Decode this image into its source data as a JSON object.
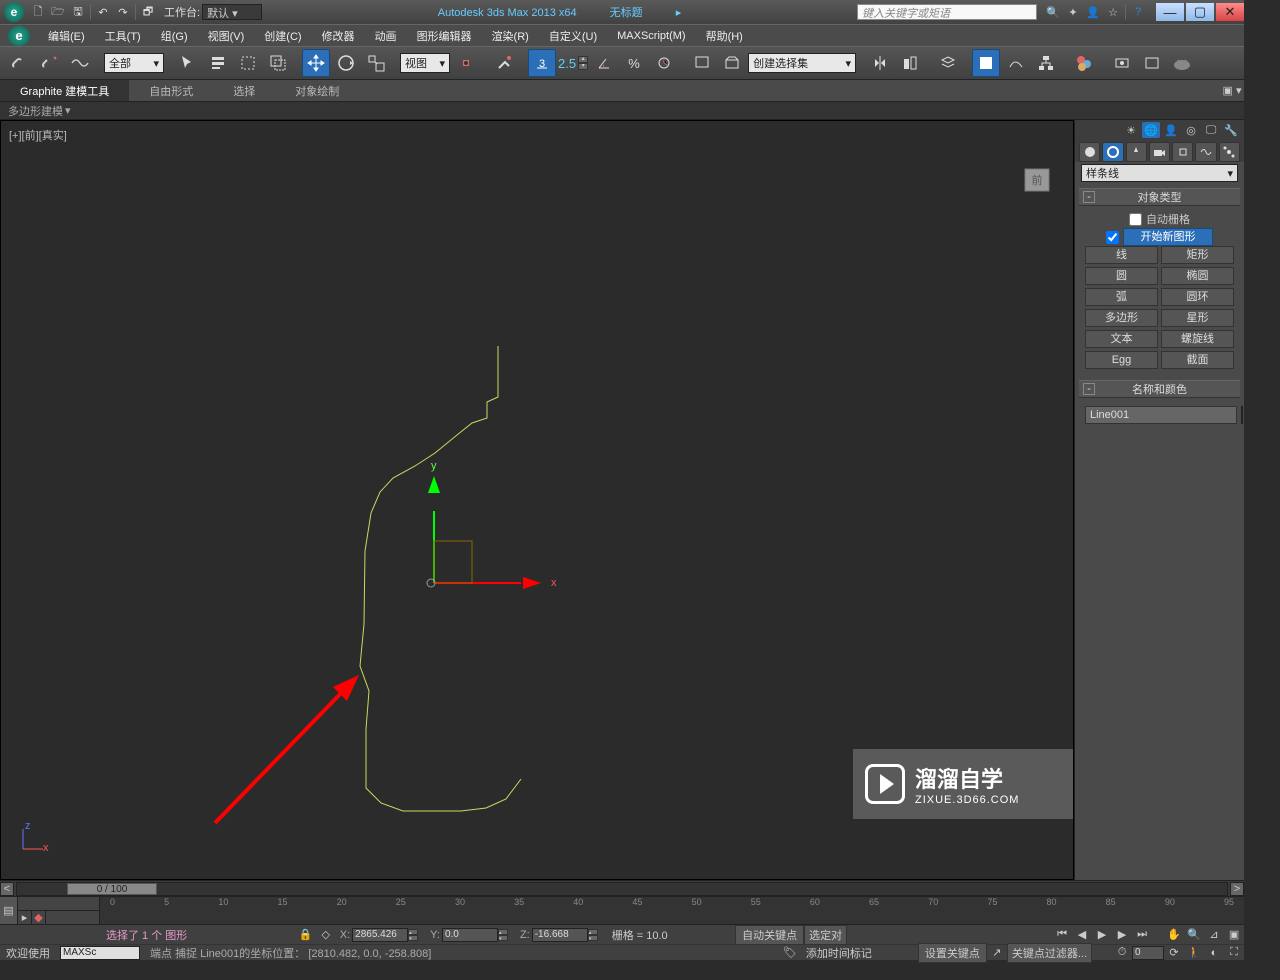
{
  "titlebar": {
    "workspace_label": "工作台:",
    "workspace_value": "默认",
    "app_title": "Autodesk 3ds Max  2013 x64",
    "doc_title": "无标题",
    "search_placeholder": "键入关键字或矩语"
  },
  "menu": [
    "编辑(E)",
    "工具(T)",
    "组(G)",
    "视图(V)",
    "创建(C)",
    "修改器",
    "动画",
    "图形编辑器",
    "渲染(R)",
    "自定义(U)",
    "MAXScript(M)",
    "帮助(H)"
  ],
  "toolbar": {
    "filter": "全部",
    "view": "视图",
    "angle": "2.5",
    "selection_set": "创建选择集"
  },
  "ribbon": {
    "tabs": [
      "Graphite 建模工具",
      "自由形式",
      "选择",
      "对象绘制"
    ],
    "panel": "多边形建模"
  },
  "viewport": {
    "label": "[+][前][真实]",
    "axis_x": "x",
    "axis_y": "y"
  },
  "cp": {
    "dropdown": "样条线",
    "rollout1_title": "对象类型",
    "auto_grid": "自动栅格",
    "start_new": "开始新图形",
    "buttons": [
      [
        "线",
        "矩形"
      ],
      [
        "圆",
        "椭圆"
      ],
      [
        "弧",
        "圆环"
      ],
      [
        "多边形",
        "星形"
      ],
      [
        "文本",
        "螺旋线"
      ],
      [
        "Egg",
        "截面"
      ]
    ],
    "rollout2_title": "名称和颜色",
    "object_name": "Line001"
  },
  "timeslider": {
    "frame": "0 / 100"
  },
  "trackbar": {
    "marks": [
      "0",
      "5",
      "10",
      "15",
      "20",
      "25",
      "30",
      "35",
      "40",
      "45",
      "50",
      "55",
      "60",
      "65",
      "70",
      "75",
      "80",
      "85",
      "90",
      "95"
    ]
  },
  "status": {
    "line1_left": "选择了 1 个 图形",
    "line1_x": "2865.426",
    "line1_y": "0.0",
    "line1_z": "-16.668",
    "grid": "栅格 = 10.0",
    "autokey": "自动关键点",
    "selkey": "选定对",
    "line2_welcome": "欢迎使用",
    "line2_maxscript": "MAXSc",
    "line2_hint": "端点 捕捉 Line001的坐标位置：",
    "line2_coords": "[2810.482, 0.0, -258.808]",
    "addtimetag": "添加时间标记",
    "setkey": "设置关键点",
    "keyfilter": "关键点过滤器..."
  },
  "watermark": {
    "big": "溜溜自学",
    "small": "ZIXUE.3D66.COM"
  }
}
